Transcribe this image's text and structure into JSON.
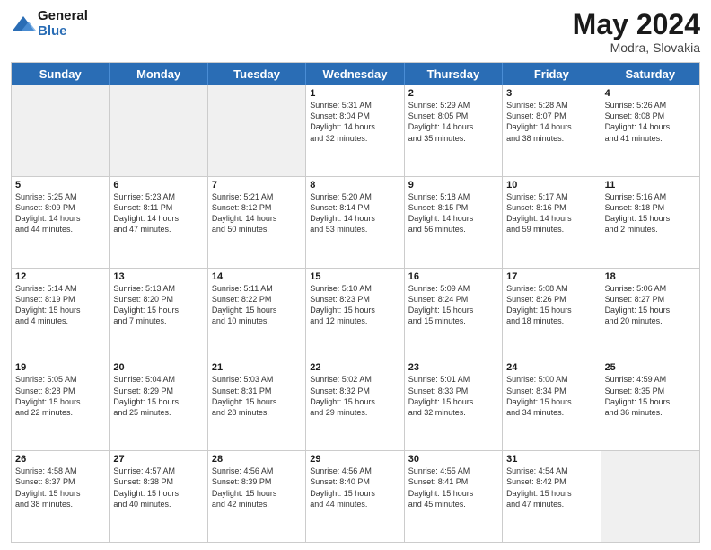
{
  "header": {
    "logo_line1": "General",
    "logo_line2": "Blue",
    "month": "May 2024",
    "location": "Modra, Slovakia"
  },
  "weekdays": [
    "Sunday",
    "Monday",
    "Tuesday",
    "Wednesday",
    "Thursday",
    "Friday",
    "Saturday"
  ],
  "rows": [
    [
      {
        "day": "",
        "info": "",
        "shaded": true
      },
      {
        "day": "",
        "info": "",
        "shaded": true
      },
      {
        "day": "",
        "info": "",
        "shaded": true
      },
      {
        "day": "1",
        "info": "Sunrise: 5:31 AM\nSunset: 8:04 PM\nDaylight: 14 hours\nand 32 minutes."
      },
      {
        "day": "2",
        "info": "Sunrise: 5:29 AM\nSunset: 8:05 PM\nDaylight: 14 hours\nand 35 minutes."
      },
      {
        "day": "3",
        "info": "Sunrise: 5:28 AM\nSunset: 8:07 PM\nDaylight: 14 hours\nand 38 minutes."
      },
      {
        "day": "4",
        "info": "Sunrise: 5:26 AM\nSunset: 8:08 PM\nDaylight: 14 hours\nand 41 minutes."
      }
    ],
    [
      {
        "day": "5",
        "info": "Sunrise: 5:25 AM\nSunset: 8:09 PM\nDaylight: 14 hours\nand 44 minutes."
      },
      {
        "day": "6",
        "info": "Sunrise: 5:23 AM\nSunset: 8:11 PM\nDaylight: 14 hours\nand 47 minutes."
      },
      {
        "day": "7",
        "info": "Sunrise: 5:21 AM\nSunset: 8:12 PM\nDaylight: 14 hours\nand 50 minutes."
      },
      {
        "day": "8",
        "info": "Sunrise: 5:20 AM\nSunset: 8:14 PM\nDaylight: 14 hours\nand 53 minutes."
      },
      {
        "day": "9",
        "info": "Sunrise: 5:18 AM\nSunset: 8:15 PM\nDaylight: 14 hours\nand 56 minutes."
      },
      {
        "day": "10",
        "info": "Sunrise: 5:17 AM\nSunset: 8:16 PM\nDaylight: 14 hours\nand 59 minutes."
      },
      {
        "day": "11",
        "info": "Sunrise: 5:16 AM\nSunset: 8:18 PM\nDaylight: 15 hours\nand 2 minutes."
      }
    ],
    [
      {
        "day": "12",
        "info": "Sunrise: 5:14 AM\nSunset: 8:19 PM\nDaylight: 15 hours\nand 4 minutes."
      },
      {
        "day": "13",
        "info": "Sunrise: 5:13 AM\nSunset: 8:20 PM\nDaylight: 15 hours\nand 7 minutes."
      },
      {
        "day": "14",
        "info": "Sunrise: 5:11 AM\nSunset: 8:22 PM\nDaylight: 15 hours\nand 10 minutes."
      },
      {
        "day": "15",
        "info": "Sunrise: 5:10 AM\nSunset: 8:23 PM\nDaylight: 15 hours\nand 12 minutes."
      },
      {
        "day": "16",
        "info": "Sunrise: 5:09 AM\nSunset: 8:24 PM\nDaylight: 15 hours\nand 15 minutes."
      },
      {
        "day": "17",
        "info": "Sunrise: 5:08 AM\nSunset: 8:26 PM\nDaylight: 15 hours\nand 18 minutes."
      },
      {
        "day": "18",
        "info": "Sunrise: 5:06 AM\nSunset: 8:27 PM\nDaylight: 15 hours\nand 20 minutes."
      }
    ],
    [
      {
        "day": "19",
        "info": "Sunrise: 5:05 AM\nSunset: 8:28 PM\nDaylight: 15 hours\nand 22 minutes."
      },
      {
        "day": "20",
        "info": "Sunrise: 5:04 AM\nSunset: 8:29 PM\nDaylight: 15 hours\nand 25 minutes."
      },
      {
        "day": "21",
        "info": "Sunrise: 5:03 AM\nSunset: 8:31 PM\nDaylight: 15 hours\nand 28 minutes."
      },
      {
        "day": "22",
        "info": "Sunrise: 5:02 AM\nSunset: 8:32 PM\nDaylight: 15 hours\nand 29 minutes."
      },
      {
        "day": "23",
        "info": "Sunrise: 5:01 AM\nSunset: 8:33 PM\nDaylight: 15 hours\nand 32 minutes."
      },
      {
        "day": "24",
        "info": "Sunrise: 5:00 AM\nSunset: 8:34 PM\nDaylight: 15 hours\nand 34 minutes."
      },
      {
        "day": "25",
        "info": "Sunrise: 4:59 AM\nSunset: 8:35 PM\nDaylight: 15 hours\nand 36 minutes."
      }
    ],
    [
      {
        "day": "26",
        "info": "Sunrise: 4:58 AM\nSunset: 8:37 PM\nDaylight: 15 hours\nand 38 minutes."
      },
      {
        "day": "27",
        "info": "Sunrise: 4:57 AM\nSunset: 8:38 PM\nDaylight: 15 hours\nand 40 minutes."
      },
      {
        "day": "28",
        "info": "Sunrise: 4:56 AM\nSunset: 8:39 PM\nDaylight: 15 hours\nand 42 minutes."
      },
      {
        "day": "29",
        "info": "Sunrise: 4:56 AM\nSunset: 8:40 PM\nDaylight: 15 hours\nand 44 minutes."
      },
      {
        "day": "30",
        "info": "Sunrise: 4:55 AM\nSunset: 8:41 PM\nDaylight: 15 hours\nand 45 minutes."
      },
      {
        "day": "31",
        "info": "Sunrise: 4:54 AM\nSunset: 8:42 PM\nDaylight: 15 hours\nand 47 minutes."
      },
      {
        "day": "",
        "info": "",
        "shaded": true
      }
    ]
  ]
}
